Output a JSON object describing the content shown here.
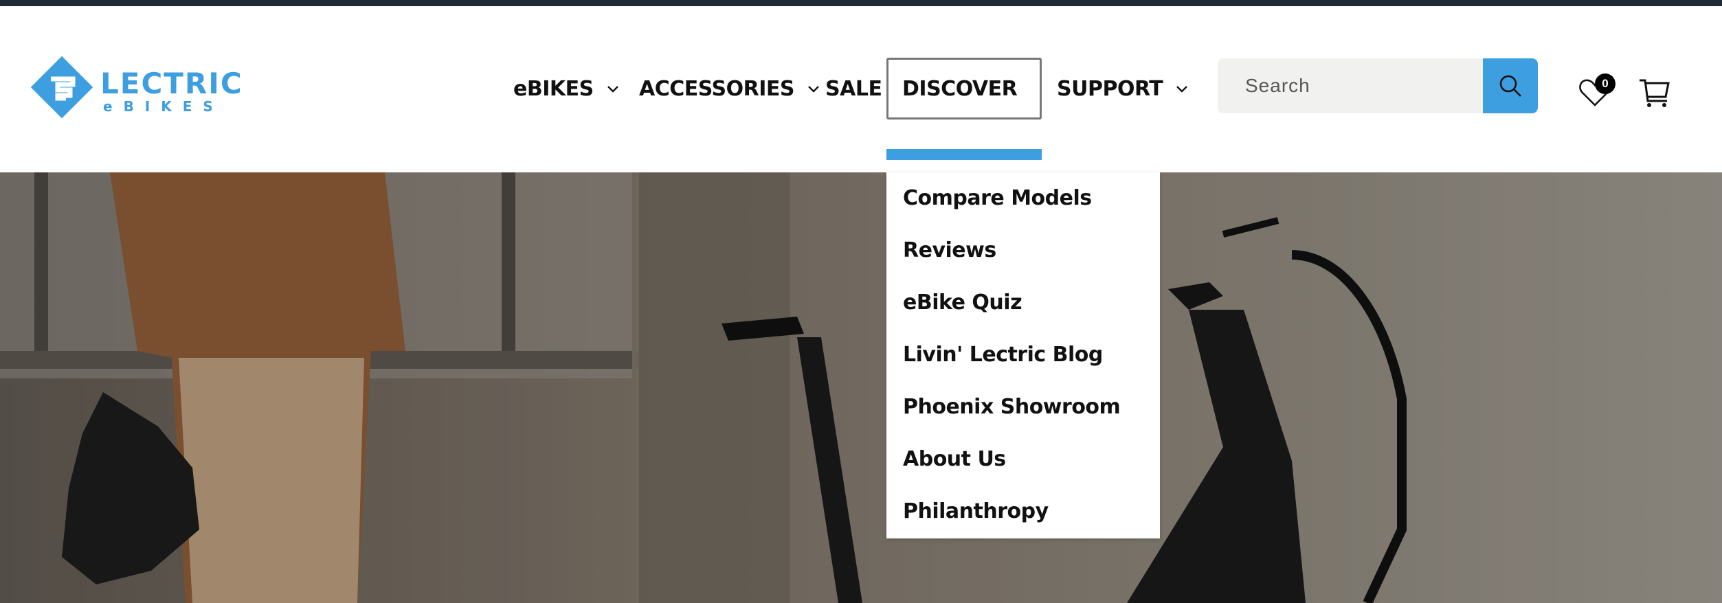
{
  "brand": {
    "main": "LECTRIC",
    "sub": "eBIKES"
  },
  "nav": [
    {
      "label": "eBIKES",
      "has_chevron": true,
      "expanded": false
    },
    {
      "label": "ACCESSORIES",
      "has_chevron": true,
      "expanded": false
    },
    {
      "label": "SALE",
      "has_chevron": false,
      "expanded": false
    },
    {
      "label": "DISCOVER",
      "has_chevron": true,
      "expanded": true
    },
    {
      "label": "SUPPORT",
      "has_chevron": true,
      "expanded": false
    }
  ],
  "search": {
    "placeholder": "Search",
    "icon": "search-icon"
  },
  "wishlist": {
    "icon": "heart-icon",
    "count": "0"
  },
  "cart": {
    "icon": "cart-icon"
  },
  "discover_menu": {
    "items": [
      "Compare Models",
      "Reviews",
      "eBike Quiz",
      "Livin' Lectric Blog",
      "Phoenix Showroom",
      "About Us",
      "Philanthropy"
    ]
  },
  "colors": {
    "accent": "#3d9ee0",
    "topbar": "#1f2a36",
    "search_bg": "#f1f2f0"
  }
}
